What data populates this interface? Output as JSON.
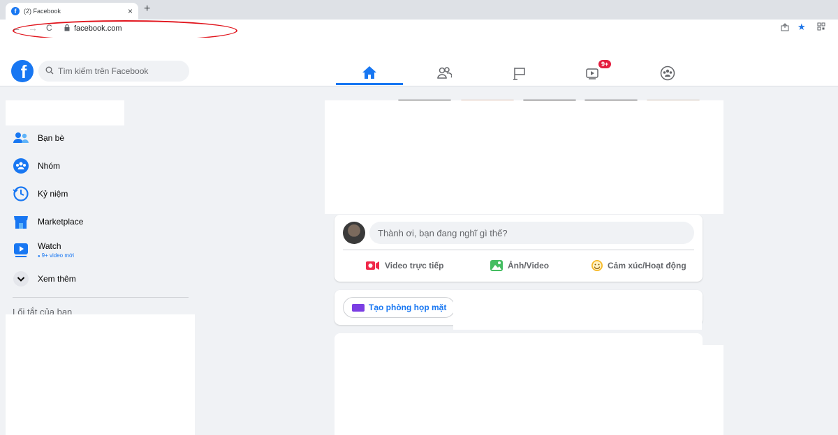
{
  "browser": {
    "tab_title": "(2) Facebook",
    "tab_close": "×",
    "new_tab": "+",
    "back": "←",
    "forward": "→",
    "reload": "C",
    "url": "facebook.com"
  },
  "header": {
    "search_placeholder": "Tìm kiếm trên Facebook",
    "watch_badge": "9+"
  },
  "sidebar": {
    "items": [
      {
        "label": "Bạn bè"
      },
      {
        "label": "Nhóm"
      },
      {
        "label": "Kỷ niệm"
      },
      {
        "label": "Marketplace"
      },
      {
        "label": "Watch",
        "sub": "9+ video mới"
      },
      {
        "label": "Xem thêm"
      }
    ],
    "shortcuts_title": "Lối tắt của bạn"
  },
  "composer": {
    "prompt": "Thành ơi, bạn đang nghĩ gì thế?",
    "actions": [
      "Video trực tiếp",
      "Ảnh/Video",
      "Cảm xúc/Hoạt động"
    ]
  },
  "rooms": {
    "button_label": "Tạo phòng họp mặt"
  },
  "colors": {
    "brand": "#1877f2",
    "annotation": "#e1141c",
    "badge": "#e41e3f"
  }
}
